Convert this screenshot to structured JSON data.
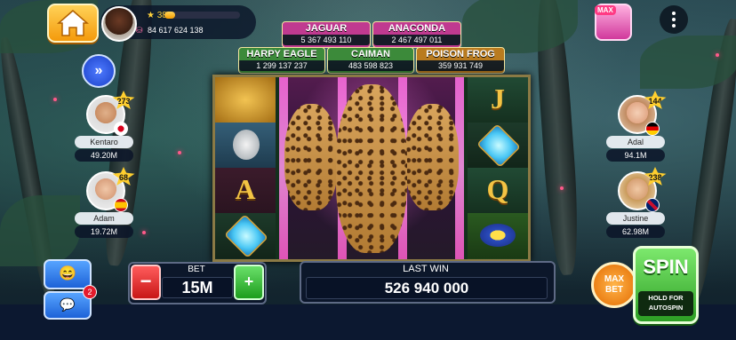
{
  "header": {
    "level": "384",
    "level_progress_percent": 14,
    "coins": "84 617 624 138"
  },
  "jackpots": [
    {
      "name": "JAGUAR",
      "value": "5 367 493 110",
      "color": "#c03a90"
    },
    {
      "name": "ANACONDA",
      "value": "2 467 497 011",
      "color": "#c03a90"
    },
    {
      "name": "HARPY EAGLE",
      "value": "1 299 137 237",
      "color": "#3c8a3a"
    },
    {
      "name": "CAIMAN",
      "value": "483 598 823",
      "color": "#3c8a3a"
    },
    {
      "name": "POISON FROG",
      "value": "359 931 749",
      "color": "#b97b1f"
    }
  ],
  "players": [
    {
      "name": "Kentaro",
      "coins": "49.20M",
      "level": "273",
      "side": "left"
    },
    {
      "name": "Adam",
      "coins": "19.72M",
      "level": "68",
      "side": "left"
    },
    {
      "name": "Adal",
      "coins": "94.1M",
      "level": "144",
      "side": "right"
    },
    {
      "name": "Justine",
      "coins": "62.98M",
      "level": "238",
      "side": "right"
    }
  ],
  "reels": {
    "col1": [
      "golden-idol",
      "harpy-eagle",
      "A",
      "gem"
    ],
    "col5": [
      "J",
      "gem",
      "Q",
      "poison-frog"
    ],
    "wild": "jaguar-wild"
  },
  "controls": {
    "bet_label": "BET",
    "bet_value": "15M",
    "minus": "−",
    "plus": "+",
    "last_win_label": "LAST WIN",
    "last_win_value": "526 940 000",
    "maxbet_line1": "MAX",
    "maxbet_line2": "BET",
    "spin_label": "SPIN",
    "spin_sub1": "HOLD FOR",
    "spin_sub2": "AUTOSPIN"
  },
  "topright": {
    "badge_label": "MAX"
  },
  "social": {
    "emoji": "😄",
    "chat_icon": "💬",
    "notification_count": "2"
  },
  "colors": {
    "accent_gold": "#f3c444",
    "spin_green": "#2d9e24",
    "minus_red": "#c81616"
  }
}
